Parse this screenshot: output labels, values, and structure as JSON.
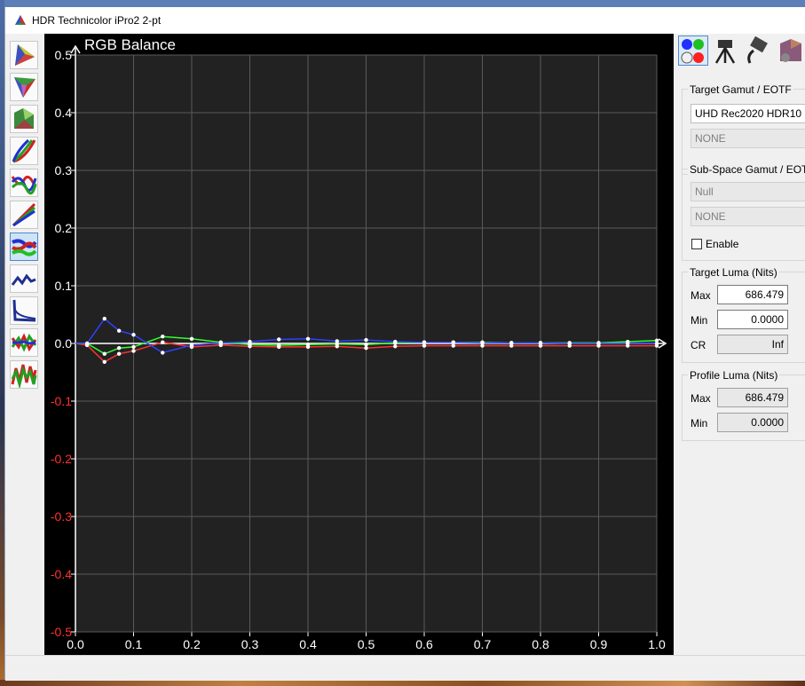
{
  "window": {
    "title": "HDR Technicolor iPro2 2-pt"
  },
  "toolbar": {
    "tools": [
      {
        "icon": "cie-1931-chart-icon"
      },
      {
        "icon": "cie-1976-chart-icon"
      },
      {
        "icon": "gamut-3d-icon"
      },
      {
        "icon": "eotf-curves-icon"
      },
      {
        "icon": "color-error-icon"
      },
      {
        "icon": "rgb-gamma-icon"
      },
      {
        "icon": "rgb-balance-icon",
        "active": true
      },
      {
        "icon": "luminance-error-icon"
      },
      {
        "icon": "luma-curve-icon"
      },
      {
        "icon": "delta-e-icon"
      },
      {
        "icon": "color-checker-icon"
      }
    ]
  },
  "chart_data": {
    "type": "line",
    "title": "RGB Balance",
    "xlabel": "",
    "ylabel": "",
    "xlim": [
      0.0,
      1.0
    ],
    "ylim": [
      -0.5,
      0.5
    ],
    "x_ticks": [
      "0.0",
      "0.1",
      "0.2",
      "0.3",
      "0.4",
      "0.5",
      "0.6",
      "0.7",
      "0.8",
      "0.9",
      "1.0"
    ],
    "y_ticks": [
      "0.5",
      "0.4",
      "0.3",
      "0.2",
      "0.1",
      "0.0",
      "-0.1",
      "-0.2",
      "-0.3",
      "-0.4",
      "-0.5"
    ],
    "grid": true,
    "x": [
      0.0,
      0.02,
      0.05,
      0.075,
      0.1,
      0.15,
      0.2,
      0.25,
      0.3,
      0.35,
      0.4,
      0.45,
      0.5,
      0.55,
      0.6,
      0.65,
      0.7,
      0.75,
      0.8,
      0.85,
      0.9,
      0.95,
      1.0
    ],
    "series": [
      {
        "color": "#ff3030",
        "values": [
          0,
          -0.003,
          -0.032,
          -0.018,
          -0.013,
          0.002,
          -0.006,
          -0.003,
          -0.005,
          -0.006,
          -0.006,
          -0.005,
          -0.008,
          -0.005,
          -0.004,
          -0.004,
          -0.004,
          -0.004,
          -0.004,
          -0.004,
          -0.004,
          -0.004,
          -0.004
        ]
      },
      {
        "color": "#30ff30",
        "values": [
          0,
          0.0,
          -0.018,
          -0.008,
          -0.006,
          0.012,
          0.008,
          0.002,
          -0.002,
          -0.003,
          -0.002,
          -0.001,
          -0.002,
          0.001,
          0.002,
          0.002,
          0.002,
          0.001,
          0.001,
          0.001,
          0.001,
          0.003,
          0.005
        ]
      },
      {
        "color": "#3040ff",
        "values": [
          0,
          0.0,
          0.043,
          0.022,
          0.015,
          -0.016,
          -0.003,
          0.001,
          0.003,
          0.007,
          0.008,
          0.004,
          0.006,
          0.003,
          0.002,
          0.002,
          0.001,
          0.001,
          0.001,
          0.0,
          0.0,
          0.0,
          0.0
        ]
      }
    ]
  },
  "right_panel": {
    "top_icons": [
      {
        "icon": "rgb-patches-icon",
        "active": true
      },
      {
        "icon": "meter-tripod-icon"
      },
      {
        "icon": "hdmi-cable-icon"
      },
      {
        "icon": "gamut-cube-icon"
      }
    ],
    "target_gamut": {
      "label": "Target Gamut / EOTF",
      "gamut": "UHD Rec2020 HDR10",
      "eotf": "NONE"
    },
    "subspace": {
      "label": "Sub-Space  Gamut / EOTF",
      "gamut": "Null",
      "eotf": "NONE",
      "enable_label": "Enable",
      "enabled": false
    },
    "target_luma": {
      "label": "Target Luma (Nits)",
      "max_label": "Max",
      "max": "686.479",
      "min_label": "Min",
      "min": "0.0000",
      "cr_label": "CR",
      "cr": "Inf"
    },
    "profile_luma": {
      "label": "Profile Luma (Nits)",
      "max_label": "Max",
      "max": "686.479",
      "min_label": "Min",
      "min": "0.0000"
    }
  }
}
